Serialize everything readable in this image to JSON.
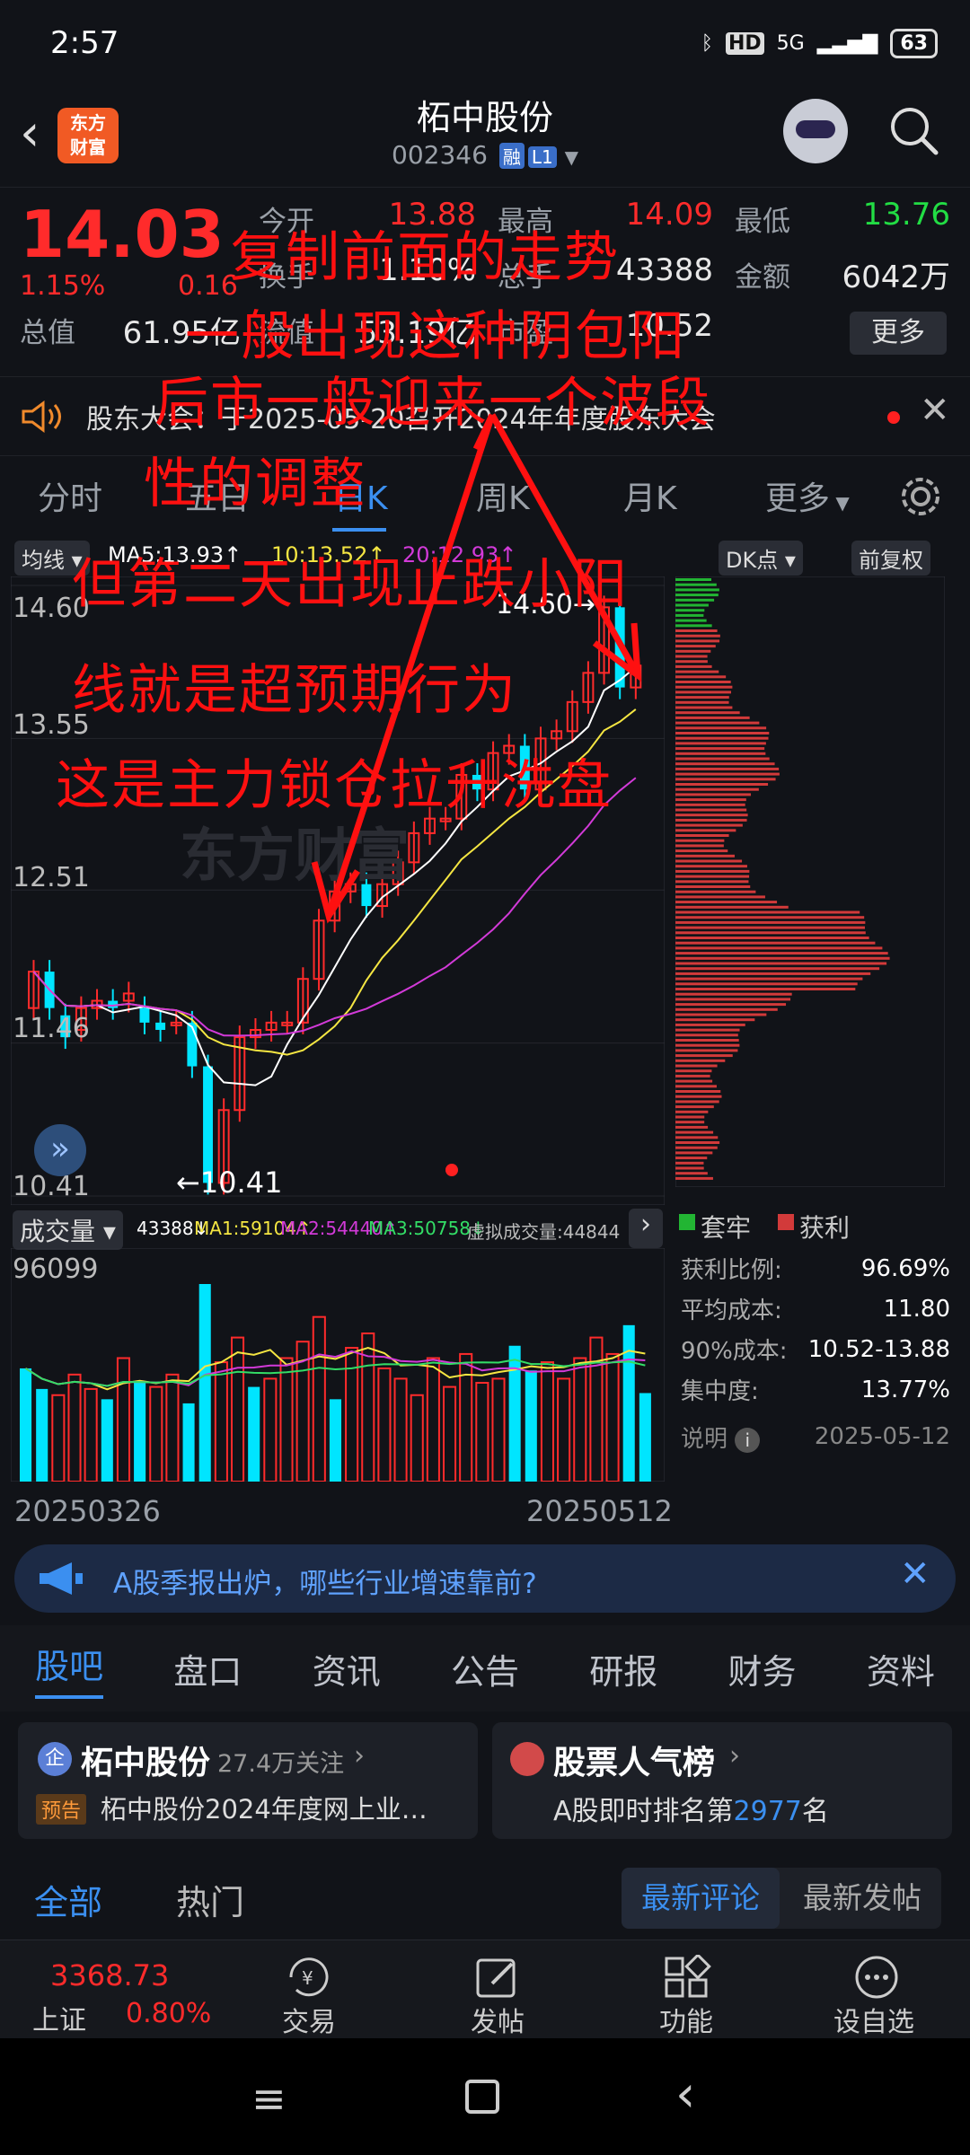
{
  "status": {
    "time": "2:57",
    "network": "5G",
    "battery": "63"
  },
  "header": {
    "title": "柘中股份",
    "code": "002346",
    "tag1": "融",
    "tag2": "L1",
    "logo_line1": "东方",
    "logo_line2": "财富"
  },
  "quote": {
    "price": "14.03",
    "pct": "1.15%",
    "chg": "0.16",
    "open_label": "今开",
    "open": "13.88",
    "high_label": "最高",
    "high": "14.09",
    "low_label": "最低",
    "low": "13.76",
    "turnover_label": "换手",
    "turnover": "1.10%",
    "volume_label": "总手",
    "volume": "43388",
    "amount_label": "金额",
    "amount": "6042万",
    "mcap_label": "总值",
    "mcap": "61.95亿",
    "float_label": "流值",
    "float": "53.19亿",
    "pe_label": "市盈",
    "pe": "10.52",
    "more": "更多"
  },
  "notice": {
    "text": "股东大会：于2025-05-20召开2024年年度股东大会"
  },
  "ktabs": [
    "分时",
    "五日",
    "日K",
    "周K",
    "月K",
    "更多"
  ],
  "ma": {
    "selector": "均线",
    "ma5": "MA5:13.93↑",
    "ma10": "10:13.52↑",
    "ma20": "20:12.93↑",
    "dk": "DK点",
    "adjust": "前复权"
  },
  "axis": {
    "y1": "14.60",
    "y2": "13.55",
    "y3": "12.51",
    "y4": "11.46",
    "y5": "10.41",
    "high_mark": "14.60→",
    "low_mark": "←10.41",
    "watermark": "东方财富"
  },
  "chip": {
    "legend_hold": "套牢",
    "legend_profit": "获利",
    "rows": [
      {
        "label": "获利比例:",
        "value": "96.69%"
      },
      {
        "label": "平均成本:",
        "value": "11.80"
      },
      {
        "label": "90%成本:",
        "value": "10.52-13.88"
      },
      {
        "label": "集中度:",
        "value": "13.77%"
      }
    ],
    "note": "说明",
    "date": "2025-05-12"
  },
  "volume": {
    "selector": "成交量",
    "vol": "43388↓",
    "ma1": "MA1:59104↑",
    "ma2": "MA2:54440↑",
    "ma3": "MA3:50758↓",
    "virtual": "虚拟成交量:44844",
    "max": "96099"
  },
  "dates": {
    "start": "20250326",
    "end": "20250512"
  },
  "banner": {
    "text": "A股季报出炉，哪些行业增速靠前?"
  },
  "section_tabs": [
    "股吧",
    "盘口",
    "资讯",
    "公告",
    "研报",
    "财务",
    "资料"
  ],
  "card1": {
    "title": "柘中股份",
    "follow": "27.4万关注",
    "badge": "预告",
    "text": "柘中股份2024年度网上业…"
  },
  "card2": {
    "title": "股票人气榜",
    "text_pre": "A股即时排名第",
    "rank": "2977",
    "text_post": "名"
  },
  "filter": {
    "all": "全部",
    "hot": "热门",
    "latest_comment": "最新评论",
    "latest_post": "最新发帖"
  },
  "bottom": {
    "index_value": "3368.73",
    "index_name": "上证",
    "index_pct": "0.80%",
    "trade": "交易",
    "post": "发帖",
    "func": "功能",
    "watch": "设自选"
  },
  "annotations": [
    "复制前面的走势",
    "一般出现这种阴包阳",
    "后市一般迎来一个波段",
    "性的调整",
    "但第二天出现止跌小阳",
    "线就是超预期行为",
    "这是主力锁仓拉升洗盘"
  ],
  "chart_data": {
    "type": "candlestick",
    "x_range": [
      "20250326",
      "20250512"
    ],
    "ylim": [
      10.41,
      14.6
    ],
    "y_ticks": [
      14.6,
      13.55,
      12.51,
      11.46,
      10.41
    ],
    "series": [
      {
        "name": "MA5",
        "last": 13.93
      },
      {
        "name": "MA10",
        "last": 13.52
      },
      {
        "name": "MA20",
        "last": 12.93
      }
    ],
    "volume": {
      "ymax": 96099,
      "last": 43388,
      "ma1": 59104,
      "ma2": 54440,
      "ma3": 50758
    }
  },
  "colors": {
    "up": "#ff2b2b",
    "down": "#00e5ff",
    "accent": "#3b8ff0",
    "annotation": "#ff1010"
  }
}
